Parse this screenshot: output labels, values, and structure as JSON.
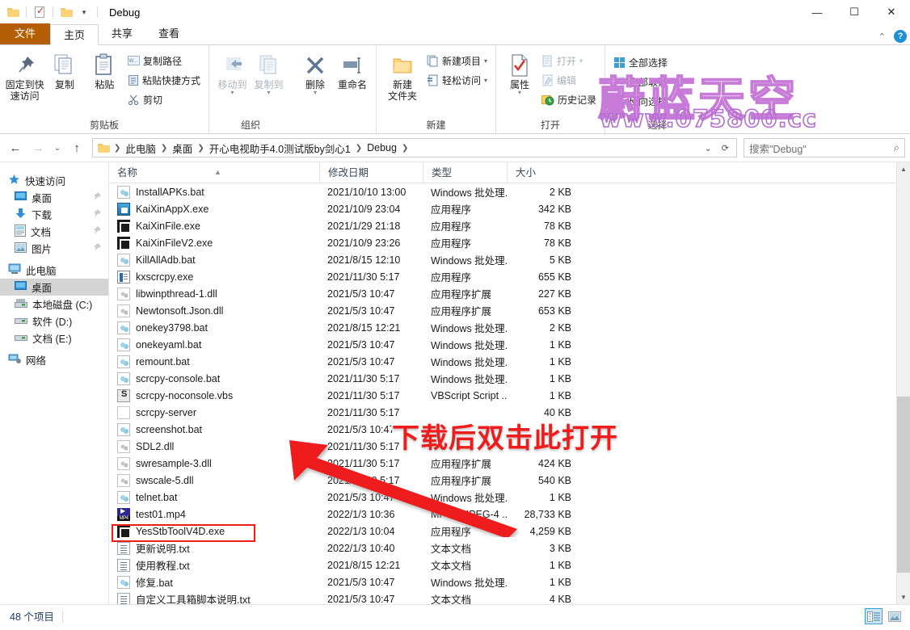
{
  "window": {
    "title": "Debug",
    "quick_access": [
      "folder-icon",
      "properties-check-icon",
      "folder-dropdown-icon"
    ],
    "controls": {
      "minimize": "—",
      "maximize": "☐",
      "close": "✕"
    }
  },
  "tabs": [
    {
      "label": "文件",
      "name": "tab-file",
      "active": false,
      "file": true
    },
    {
      "label": "主页",
      "name": "tab-home",
      "active": true,
      "file": false
    },
    {
      "label": "共享",
      "name": "tab-share",
      "active": false,
      "file": false
    },
    {
      "label": "查看",
      "name": "tab-view",
      "active": false,
      "file": false
    }
  ],
  "ribbon": {
    "collapse_icon": "chevron-up-icon",
    "help_icon": "help-icon",
    "groups": [
      {
        "label": "剪贴板",
        "big": [
          {
            "label": "固定到快\n速访问",
            "icon": "pin-icon"
          },
          {
            "label": "复制",
            "icon": "copy-icon"
          },
          {
            "label": "粘贴",
            "icon": "paste-icon"
          }
        ],
        "small": [
          "复制路径",
          "粘贴快捷方式",
          "剪切"
        ]
      },
      {
        "label": "组织",
        "big": [
          {
            "label": "移动到",
            "icon": "move-to-icon"
          },
          {
            "label": "复制到",
            "icon": "copy-to-icon"
          },
          {
            "label": "删除",
            "icon": "delete-icon"
          },
          {
            "label": "重命名",
            "icon": "rename-icon"
          }
        ],
        "small": []
      },
      {
        "label": "新建",
        "big": [
          {
            "label": "新建\n文件夹",
            "icon": "new-folder-icon"
          }
        ],
        "small": [
          "新建项目",
          "轻松访问"
        ]
      },
      {
        "label": "打开",
        "big": [
          {
            "label": "属性",
            "icon": "properties-icon"
          }
        ],
        "small": [
          "打开",
          "编辑",
          "历史记录"
        ]
      },
      {
        "label": "选择",
        "big": [],
        "small": [
          "全部选择",
          "全部取消",
          "反向选择"
        ]
      }
    ]
  },
  "address": {
    "back_icon": "back-arrow-icon",
    "forward_icon": "forward-arrow-icon",
    "recent_icon": "chevron-down-icon",
    "up_icon": "up-arrow-icon",
    "crumbs": [
      "此电脑",
      "桌面",
      "开心电视助手4.0测试版by剑心1",
      "Debug"
    ],
    "refresh_icon": "refresh-icon",
    "search_placeholder": "搜索\"Debug\"",
    "search_value": "",
    "search_icon": "search-icon"
  },
  "nav_pane": [
    {
      "label": "快速访问",
      "icon": "star-icon",
      "indent": 0,
      "pin": false,
      "selected": false
    },
    {
      "label": "桌面",
      "icon": "desktop-icon",
      "indent": 1,
      "pin": true,
      "selected": false
    },
    {
      "label": "下载",
      "icon": "download-icon",
      "indent": 1,
      "pin": true,
      "selected": false
    },
    {
      "label": "文档",
      "icon": "documents-icon",
      "indent": 1,
      "pin": true,
      "selected": false
    },
    {
      "label": "图片",
      "icon": "pictures-icon",
      "indent": 1,
      "pin": true,
      "selected": false
    },
    {
      "label": "此电脑",
      "icon": "this-pc-icon",
      "indent": 0,
      "pin": false,
      "selected": false
    },
    {
      "label": "桌面",
      "icon": "desktop-icon",
      "indent": 1,
      "pin": false,
      "selected": true
    },
    {
      "label": "本地磁盘 (C:)",
      "icon": "drive-icon",
      "indent": 1,
      "pin": false,
      "selected": false
    },
    {
      "label": "软件 (D:)",
      "icon": "drive-icon",
      "indent": 1,
      "pin": false,
      "selected": false
    },
    {
      "label": "文档 (E:)",
      "icon": "drive-icon",
      "indent": 1,
      "pin": false,
      "selected": false
    },
    {
      "label": "网络",
      "icon": "network-icon",
      "indent": 0,
      "pin": false,
      "selected": false
    }
  ],
  "columns": [
    {
      "label": "名称",
      "sorted": true
    },
    {
      "label": "修改日期",
      "sorted": false
    },
    {
      "label": "类型",
      "sorted": false
    },
    {
      "label": "大小",
      "sorted": false
    }
  ],
  "files": [
    {
      "name": "InstallAPKs.bat",
      "date": "2021/10/10 13:00",
      "type": "Windows 批处理...",
      "size": "2 KB",
      "icon": "bat"
    },
    {
      "name": "KaiXinAppX.exe",
      "date": "2021/10/9 23:04",
      "type": "应用程序",
      "size": "342 KB",
      "icon": "kxapp"
    },
    {
      "name": "KaiXinFile.exe",
      "date": "2021/1/29 21:18",
      "type": "应用程序",
      "size": "78 KB",
      "icon": "exe-dark"
    },
    {
      "name": "KaiXinFileV2.exe",
      "date": "2021/10/9 23:26",
      "type": "应用程序",
      "size": "78 KB",
      "icon": "exe-dark"
    },
    {
      "name": "KillAllAdb.bat",
      "date": "2021/8/15 12:10",
      "type": "Windows 批处理...",
      "size": "5 KB",
      "icon": "bat"
    },
    {
      "name": "kxscrcpy.exe",
      "date": "2021/11/30 5:17",
      "type": "应用程序",
      "size": "655 KB",
      "icon": "kxs"
    },
    {
      "name": "libwinpthread-1.dll",
      "date": "2021/5/3 10:47",
      "type": "应用程序扩展",
      "size": "227 KB",
      "icon": "dll"
    },
    {
      "name": "Newtonsoft.Json.dll",
      "date": "2021/5/3 10:47",
      "type": "应用程序扩展",
      "size": "653 KB",
      "icon": "dll"
    },
    {
      "name": "onekey3798.bat",
      "date": "2021/8/15 12:21",
      "type": "Windows 批处理...",
      "size": "2 KB",
      "icon": "bat"
    },
    {
      "name": "onekeyaml.bat",
      "date": "2021/5/3 10:47",
      "type": "Windows 批处理...",
      "size": "1 KB",
      "icon": "bat"
    },
    {
      "name": "remount.bat",
      "date": "2021/5/3 10:47",
      "type": "Windows 批处理...",
      "size": "1 KB",
      "icon": "bat"
    },
    {
      "name": "scrcpy-console.bat",
      "date": "2021/11/30 5:17",
      "type": "Windows 批处理...",
      "size": "1 KB",
      "icon": "bat"
    },
    {
      "name": "scrcpy-noconsole.vbs",
      "date": "2021/11/30 5:17",
      "type": "VBScript Script ...",
      "size": "1 KB",
      "icon": "vbs"
    },
    {
      "name": "scrcpy-server",
      "date": "2021/11/30 5:17",
      "type": "",
      "size": "40 KB",
      "icon": "plain"
    },
    {
      "name": "screenshot.bat",
      "date": "2021/5/3 10:47",
      "type": "",
      "size": "",
      "icon": "bat"
    },
    {
      "name": "SDL2.dll",
      "date": "2021/11/30 5:17",
      "type": "",
      "size": "",
      "icon": "dll"
    },
    {
      "name": "swresample-3.dll",
      "date": "2021/11/30 5:17",
      "type": "应用程序扩展",
      "size": "424 KB",
      "icon": "dll"
    },
    {
      "name": "swscale-5.dll",
      "date": "2021/11/30 5:17",
      "type": "应用程序扩展",
      "size": "540 KB",
      "icon": "dll"
    },
    {
      "name": "telnet.bat",
      "date": "2021/5/3 10:47",
      "type": "Windows 批处理...",
      "size": "1 KB",
      "icon": "bat"
    },
    {
      "name": "test01.mp4",
      "date": "2022/1/3 10:36",
      "type": "MP4 - MPEG-4 ...",
      "size": "28,733 KB",
      "icon": "mp4"
    },
    {
      "name": "YesStbToolV4D.exe",
      "date": "2022/1/3 10:04",
      "type": "应用程序",
      "size": "4,259 KB",
      "icon": "exe-dark"
    },
    {
      "name": "更新说明.txt",
      "date": "2022/1/3 10:40",
      "type": "文本文档",
      "size": "3 KB",
      "icon": "txt"
    },
    {
      "name": "使用教程.txt",
      "date": "2021/8/15 12:21",
      "type": "文本文档",
      "size": "1 KB",
      "icon": "txt"
    },
    {
      "name": "修复.bat",
      "date": "2021/5/3 10:47",
      "type": "Windows 批处理...",
      "size": "1 KB",
      "icon": "bat"
    },
    {
      "name": "自定义工具箱脚本说明.txt",
      "date": "2021/5/3 10:47",
      "type": "文本文档",
      "size": "4 KB",
      "icon": "txt"
    }
  ],
  "status": {
    "item_count": "48 个项目",
    "view_details_icon": "details-view-icon",
    "view_large_icon": "large-icons-view-icon"
  },
  "annotations": {
    "callout_text": "下载后双击此打开",
    "callout_color": "#ef1c1c",
    "highlight_target": "YesStbToolV4D.exe",
    "arrow_icon": "arrow-icon"
  },
  "watermark": {
    "line1": "蔚蓝天空",
    "line2": "www.075800.cc",
    "color": "#c77ad8"
  }
}
